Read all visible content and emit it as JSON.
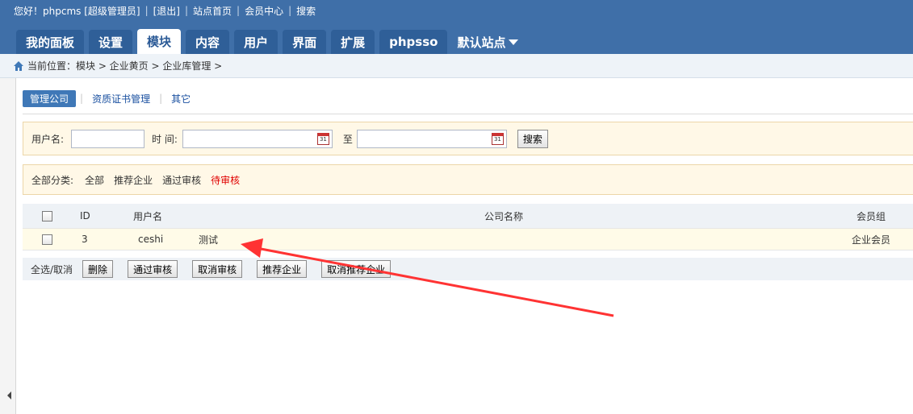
{
  "topbar": {
    "greeting": "您好！phpcms [超级管理员]",
    "logout": "[退出]",
    "site_home": "站点首页",
    "member_center": "会员中心",
    "search": "搜索"
  },
  "nav": {
    "tabs": [
      "我的面板",
      "设置",
      "模块",
      "内容",
      "用户",
      "界面",
      "扩展",
      "phpsso"
    ],
    "active_index": 2,
    "site_dropdown": "默认站点"
  },
  "breadcrumb": "当前位置：模块 > 企业黄页 > 企业库管理 >",
  "subtabs": [
    "管理公司",
    "资质证书管理",
    "其它"
  ],
  "search": {
    "username_label": "用户名:",
    "username_value": "",
    "time_label": "时 间:",
    "to_label": "至",
    "start_date": "",
    "end_date": "",
    "calendar_day": "31",
    "button": "搜索"
  },
  "categories": {
    "label": "全部分类:",
    "items": [
      "全部",
      "推荐企业",
      "通过审核",
      "待审核"
    ],
    "active_index": 3
  },
  "table": {
    "headers": {
      "id": "ID",
      "username": "用户名",
      "company": "公司名称",
      "group": "会员组"
    },
    "rows": [
      {
        "id": "3",
        "username": "ceshi",
        "company": "测试",
        "group": "企业会员"
      }
    ]
  },
  "actions": {
    "select_all": "全选/取消",
    "buttons": [
      "删除",
      "通过审核",
      "取消审核",
      "推荐企业",
      "取消推荐企业"
    ]
  },
  "colors": {
    "header_bg": "#3f6fa8",
    "annotation_arrow": "#ff3333",
    "pending_category": "#e00000"
  }
}
